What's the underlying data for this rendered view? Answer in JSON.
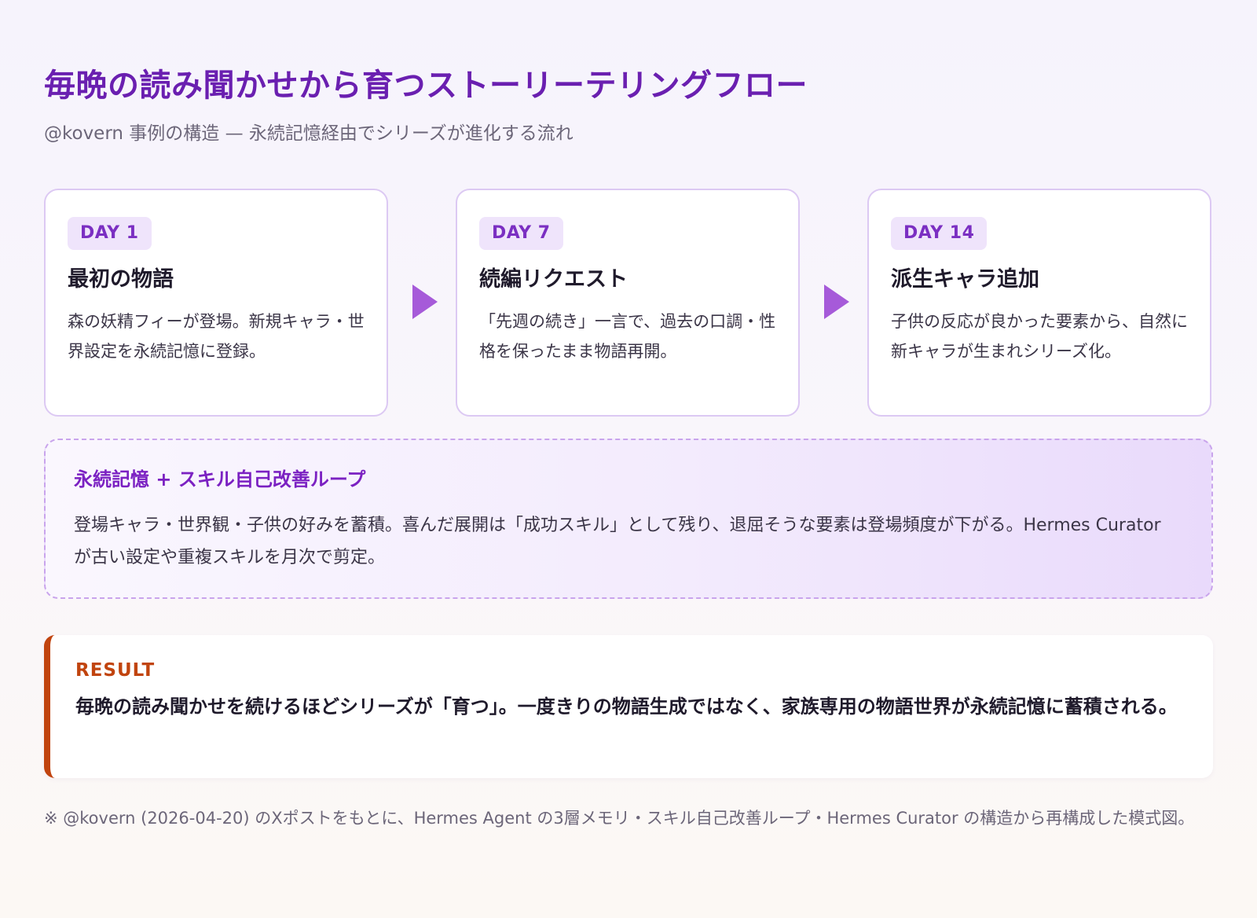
{
  "header": {
    "title": "毎晩の読み聞かせから育つストーリーテリングフロー",
    "subtitle": "@kovern 事例の構造 — 永続記憶経由でシリーズが進化する流れ"
  },
  "steps": [
    {
      "badge": "DAY 1",
      "title": "最初の物語",
      "text": "森の妖精フィーが登場。新規キャラ・世界設定を永続記憶に登録。"
    },
    {
      "badge": "DAY 7",
      "title": "続編リクエスト",
      "text": "「先週の続き」一言で、過去の口調・性格を保ったまま物語再開。"
    },
    {
      "badge": "DAY 14",
      "title": "派生キャラ追加",
      "text": "子供の反応が良かった要素から、自然に新キャラが生まれシリーズ化。"
    }
  ],
  "loop": {
    "title": "永続記憶 + スキル自己改善ループ",
    "text": "登場キャラ・世界観・子供の好みを蓄積。喜んだ展開は「成功スキル」として残り、退屈そうな要素は登場頻度が下がる。Hermes Curator が古い設定や重複スキルを月次で剪定。"
  },
  "result": {
    "label": "RESULT",
    "text": "毎晩の読み聞かせを続けるほどシリーズが「育つ」。一度きりの物語生成ではなく、家族専用の物語世界が永続記憶に蓄積される。"
  },
  "footnote": "※ @kovern (2026-04-20) のXポストをもとに、Hermes Agent の3層メモリ・スキル自己改善ループ・Hermes Curator の構造から再構成した模式図。",
  "colors": {
    "title": "#6a1fb0",
    "accent": "#a65ad9",
    "result_accent": "#c1440e"
  }
}
